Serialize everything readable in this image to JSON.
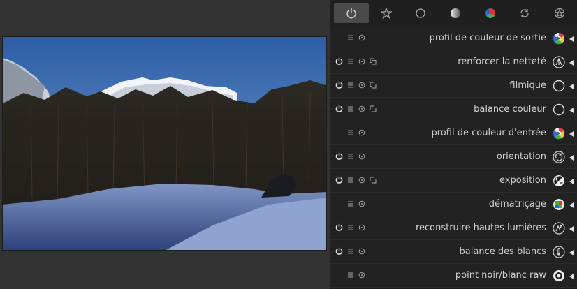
{
  "colors": {
    "panel_bg": "#1f1f1f",
    "row_bg": "#222222",
    "canvas_bg": "#333333",
    "label": "#d2d2d2",
    "icon": "#a8a8a8",
    "active_tab": "#4a4a4a"
  },
  "group_tabs": [
    {
      "icon": "power-icon",
      "active": true
    },
    {
      "icon": "star-icon",
      "active": false
    },
    {
      "icon": "circle-icon",
      "active": false
    },
    {
      "icon": "gradient-circle-icon",
      "active": false
    },
    {
      "icon": "color-circle-icon",
      "active": false
    },
    {
      "icon": "cycle-arrows-icon",
      "active": false
    },
    {
      "icon": "pentagon-star-icon",
      "active": false
    }
  ],
  "modules": [
    {
      "label": "profil de couleur de sortie",
      "icon": "color-profile-icon",
      "power": false,
      "multi": false
    },
    {
      "label": "renforcer la netteté",
      "icon": "sharpen-icon",
      "power": true,
      "multi": true
    },
    {
      "label": "filmique",
      "icon": "circle-icon",
      "power": true,
      "multi": true
    },
    {
      "label": "balance couleur",
      "icon": "circle-icon",
      "power": true,
      "multi": true
    },
    {
      "label": "profil de couleur d'entrée",
      "icon": "color-profile-icon",
      "power": false,
      "multi": false
    },
    {
      "label": "orientation",
      "icon": "rotate-icon",
      "power": true,
      "multi": false
    },
    {
      "label": "exposition",
      "icon": "exposure-icon",
      "power": true,
      "multi": true
    },
    {
      "label": "dématriçage",
      "icon": "demosaic-icon",
      "power": false,
      "multi": false
    },
    {
      "label": "reconstruire hautes lumières",
      "icon": "highlights-icon",
      "power": true,
      "multi": false
    },
    {
      "label": "balance des blancs",
      "icon": "thermometer-icon",
      "power": true,
      "multi": false
    },
    {
      "label": "point noir/blanc raw",
      "icon": "raw-point-icon",
      "power": false,
      "multi": false
    }
  ]
}
